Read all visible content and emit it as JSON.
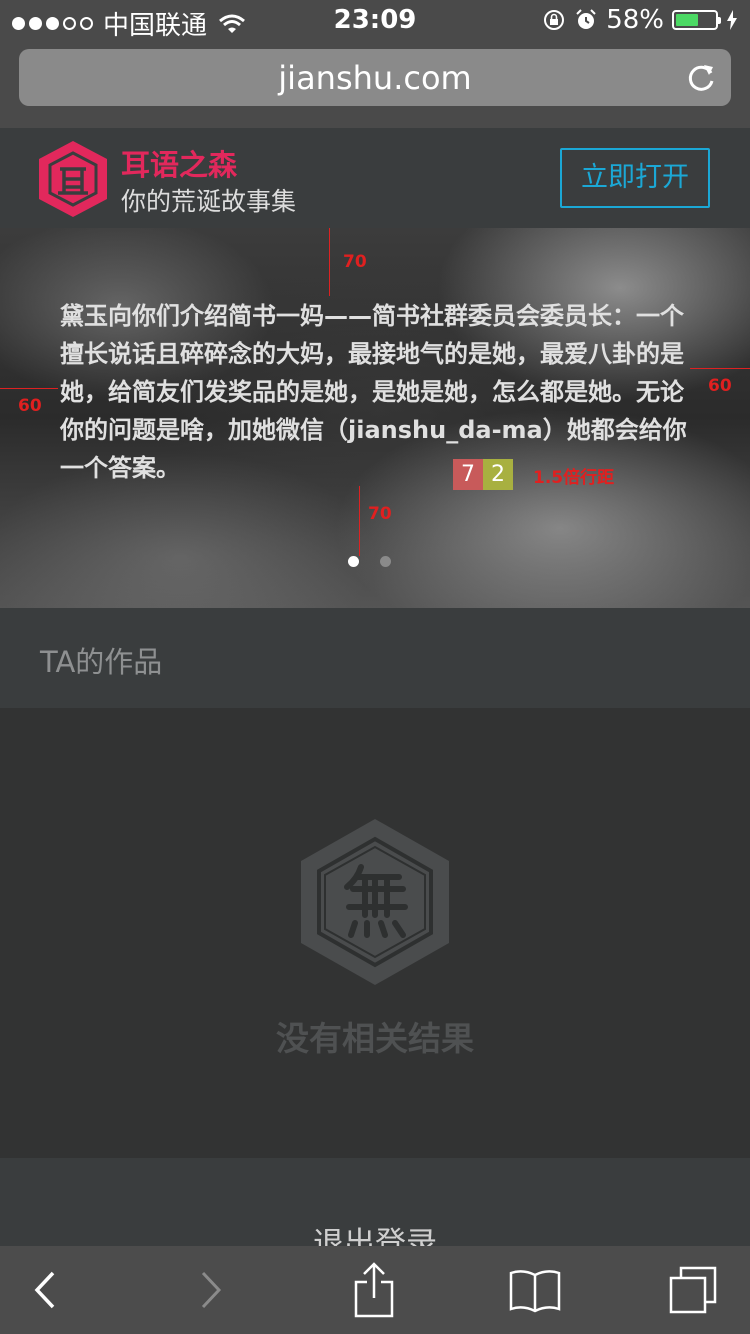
{
  "status_bar": {
    "carrier": "中国联通",
    "time": "23:09",
    "battery": "58%",
    "battery_level": 0.58
  },
  "browser": {
    "url": "jianshu.com"
  },
  "app_banner": {
    "name": "耳语之森",
    "subtitle": "你的荒诞故事集",
    "open_label": "立即打开"
  },
  "hero": {
    "text": "黛玉向你们介绍简书一妈——简书社群委员会委员长：一个擅长说话且碎碎念的大妈，最接地气的是她，最爱八卦的是她，给简友们发奖品的是她，是她是她，怎么都是她。无论你的问题是啥，加她微信（jianshu_da-ma）她都会给你一个答案。",
    "annotations": {
      "top": "70",
      "bottom": "70",
      "left": "60",
      "right": "60",
      "chip_a": "7",
      "chip_b": "2",
      "line_spacing": "1.5倍行距"
    },
    "pager_count": 2,
    "pager_active": 0
  },
  "works": {
    "title": "TA的作品",
    "empty_text": "没有相关结果"
  },
  "logout_label": "退出登录",
  "colors": {
    "brand": "#e2285c",
    "accent": "#1ba8d6",
    "annotation": "#e02020",
    "chip_a": "#c85a5a",
    "chip_b": "#a8b040"
  }
}
